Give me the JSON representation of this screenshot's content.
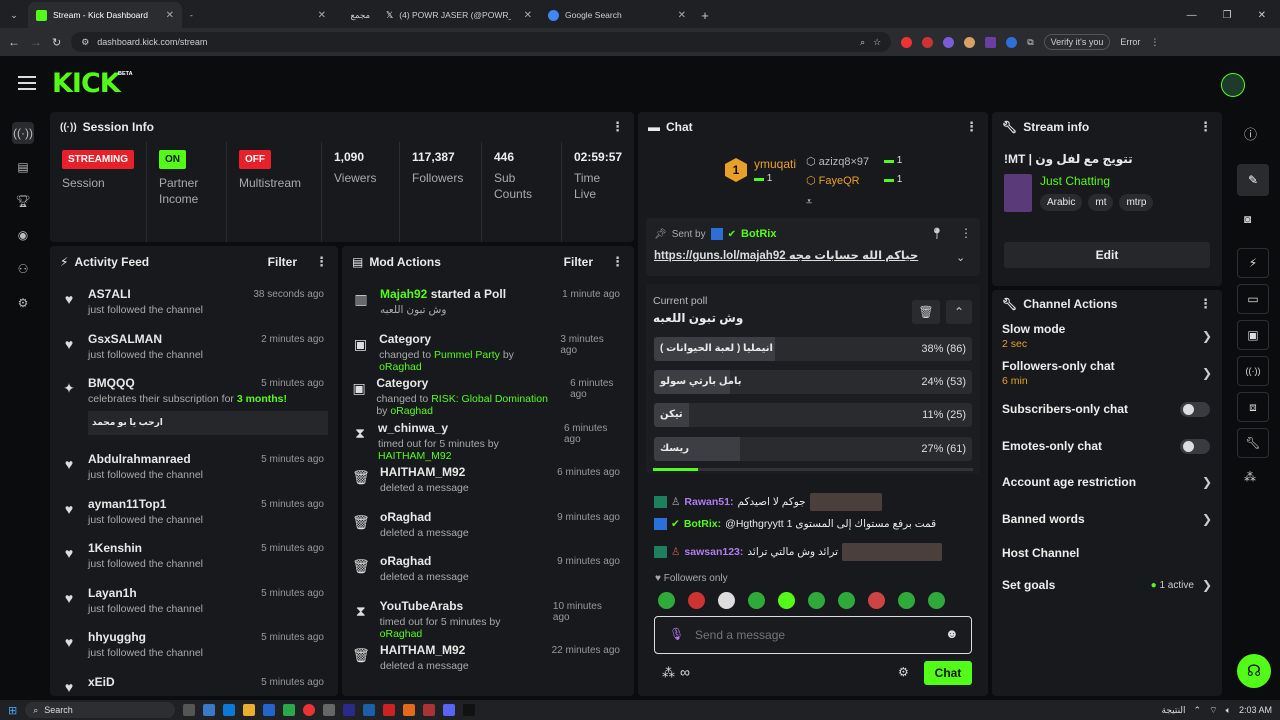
{
  "browser": {
    "tabs": [
      {
        "title": "Stream - Kick Dashboard",
        "active": true,
        "favicon_color": "#53fc18"
      },
      {
        "title": "-",
        "active": false,
        "favicon_color": "#777"
      },
      {
        "title": "مجمع",
        "active": false,
        "favicon_color": "#777"
      },
      {
        "title": "(4) POWR JASER (@POWR_JASI",
        "active": false,
        "favicon_color": "#fff"
      },
      {
        "title": "Google Search",
        "active": false,
        "favicon_color": "#4285f4"
      }
    ],
    "url": "dashboard.kick.com/stream",
    "profile": "Verify it's you",
    "error": "Error"
  },
  "kick": {
    "logo": "KICK",
    "beta": "BETA",
    "accent": "#53fc18"
  },
  "session": {
    "title": "Session Info",
    "streaming_badge": "STREAMING",
    "session_label": "Session",
    "partner_badge": "ON",
    "partner_label": "Partner Income",
    "multi_badge": "OFF",
    "multi_label": "Multistream",
    "stats": [
      {
        "value": "1,090",
        "label": "Viewers"
      },
      {
        "value": "117,387",
        "label": "Followers"
      },
      {
        "value": "446",
        "label": "Sub Counts"
      },
      {
        "value": "02:59:57",
        "label": "Time Live"
      }
    ]
  },
  "activity": {
    "title": "Activity Feed",
    "filter": "Filter",
    "items": [
      {
        "icon": "heart-icon",
        "name": "AS7ALI",
        "sub": "just followed the channel",
        "time": "38 seconds ago"
      },
      {
        "icon": "heart-icon",
        "name": "GsxSALMAN",
        "sub": "just followed the channel",
        "time": "2 minutes ago"
      },
      {
        "icon": "star-icon",
        "name": "BMQQQ",
        "sub_prefix": "celebrates their subscription for",
        "sub_num": "3 months!",
        "message": "ارحب يا بو محمد",
        "time": "5 minutes ago"
      },
      {
        "icon": "heart-icon",
        "name": "Abdulrahmanraed",
        "sub": "just followed the channel",
        "time": "5 minutes ago"
      },
      {
        "icon": "heart-icon",
        "name": "ayman11Top1",
        "sub": "just followed the channel",
        "time": "5 minutes ago"
      },
      {
        "icon": "heart-icon",
        "name": "1Kenshin",
        "sub": "just followed the channel",
        "time": "5 minutes ago"
      },
      {
        "icon": "heart-icon",
        "name": "Layan1h",
        "sub": "just followed the channel",
        "time": "5 minutes ago"
      },
      {
        "icon": "heart-icon",
        "name": "hhyugghg",
        "sub": "just followed the channel",
        "time": "5 minutes ago"
      },
      {
        "icon": "heart-icon",
        "name": "xEiD",
        "sub": "",
        "time": "5 minutes ago"
      }
    ]
  },
  "mod": {
    "title": "Mod Actions",
    "filter": "Filter",
    "items": [
      {
        "icon": "poll-icon",
        "name": "Majah92",
        "name_rest": " started a Poll",
        "sub": "وش تبون اللعبه",
        "time": "1 minute ago",
        "green_name": true
      },
      {
        "icon": "category-icon",
        "name": "Category",
        "sub_prefix": "changed to",
        "sub_green": "Pummel Party",
        "sub_by": "by",
        "sub_user": "oRaghad",
        "time": "3 minutes ago"
      },
      {
        "icon": "category-icon",
        "name": "Category",
        "sub_prefix": "changed to",
        "sub_green": "RISK: Global Domination",
        "sub_by": "by",
        "sub_user": "oRaghad",
        "time": "6 minutes ago"
      },
      {
        "icon": "timeout-icon",
        "name": "w_chinwa_y",
        "sub_prefix": "timed out for 5 minutes",
        "sub_by": "by",
        "sub_user": "HAITHAM_M92",
        "time": "6 minutes ago"
      },
      {
        "icon": "trash-icon",
        "name": "HAITHAM_M92",
        "sub": "deleted a message",
        "time": "6 minutes ago"
      },
      {
        "icon": "trash-icon",
        "name": "oRaghad",
        "sub": "deleted a message",
        "time": "9 minutes ago"
      },
      {
        "icon": "trash-icon",
        "name": "oRaghad",
        "sub": "deleted a message",
        "time": "9 minutes ago"
      },
      {
        "icon": "timeout-icon",
        "name": "YouTubeArabs",
        "sub_prefix": "timed out for 5 minutes",
        "sub_by": "by",
        "sub_user": "oRaghad",
        "time": "10 minutes ago"
      },
      {
        "icon": "trash-icon",
        "name": "HAITHAM_M92",
        "sub": "deleted a message",
        "time": "22 minutes ago"
      }
    ]
  },
  "chat": {
    "title": "Chat",
    "leaderboard": [
      {
        "rank": "1",
        "name": "ymuqati",
        "count": "1"
      },
      {
        "name": "azizq8×97",
        "count": "1"
      },
      {
        "name": "FayeQR",
        "count": "1"
      }
    ],
    "pinned": {
      "sent_by": "Sent by",
      "user": "BotRix",
      "text": "https://guns.lol/majah92 حياكم الله حسابات مجه"
    },
    "poll": {
      "label": "Current poll",
      "question": "وش تبون اللعبه",
      "options": [
        {
          "text": "انيمليا ( لعبة الحيوانات )",
          "percent": 38,
          "display": "38% (86)"
        },
        {
          "text": "بامل بارتي سولو",
          "percent": 24,
          "display": "24% (53)"
        },
        {
          "text": "تيكن",
          "percent": 11,
          "display": "11% (25)"
        },
        {
          "text": "ريسك",
          "percent": 27,
          "display": "27% (61)"
        }
      ],
      "progress": 0.14
    },
    "messages": [
      {
        "user": "Rawan51:",
        "text": "جوكم لا اصيدكم",
        "color": "#b07cf0"
      },
      {
        "user": "BotRix:",
        "text": "@Hgthgryytt قمت برفع مستواك إلى المستوى 1",
        "color": "#53fc18"
      },
      {
        "user": "sawsan123:",
        "text": "ترائد وش مالتي ترائد",
        "color": "#b07cf0"
      }
    ],
    "followers_only": "Followers only",
    "input_placeholder": "Send a message",
    "send_button": "Chat"
  },
  "stream_info": {
    "title": "Stream info",
    "stream_title": "!MT | تتويج مع لفل ون",
    "category": "Just Chatting",
    "tags": [
      "Arabic",
      "mt",
      "mtrp"
    ],
    "edit_button": "Edit"
  },
  "channel_actions": {
    "title": "Channel Actions",
    "items": [
      {
        "name": "Slow mode",
        "sub": "2 sec",
        "type": "chevron"
      },
      {
        "name": "Followers-only chat",
        "sub": "6 min",
        "type": "chevron"
      },
      {
        "name": "Subscribers-only chat",
        "type": "toggle"
      },
      {
        "name": "Emotes-only chat",
        "type": "toggle"
      },
      {
        "name": "Account age restriction",
        "type": "chevron"
      },
      {
        "name": "Banned words",
        "type": "chevron"
      },
      {
        "name": "Host Channel",
        "type": "none"
      },
      {
        "name": "Set goals",
        "type": "chevron",
        "status": "1 active"
      }
    ]
  },
  "taskbar": {
    "search": "Search",
    "time": "2:03 AM",
    "lang": "النتيجة"
  }
}
